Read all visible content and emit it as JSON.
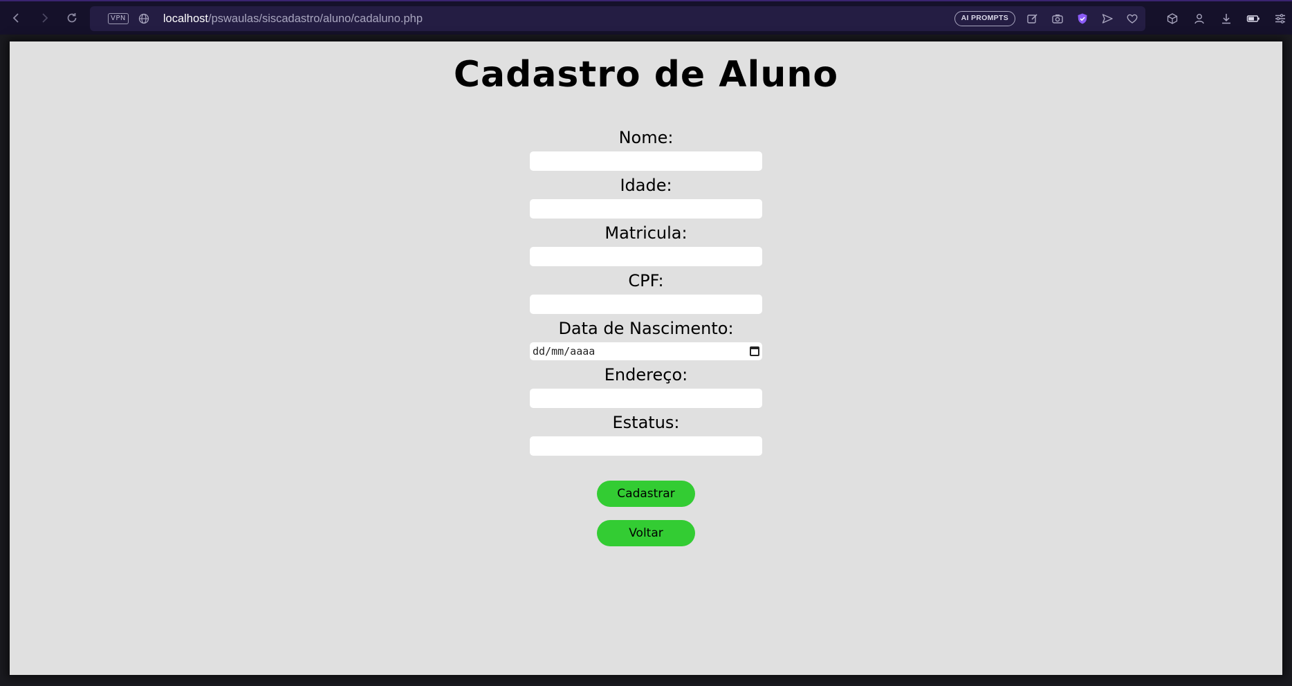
{
  "browser": {
    "vpn_label": "VPN",
    "url_host": "localhost",
    "url_path": "/pswaulas/siscadastro/aluno/cadaluno.php",
    "ai_prompts_label": "AI PROMPTS",
    "accent_color": "#8b5cf6"
  },
  "page": {
    "title": "Cadastro de Aluno",
    "background": "#e0e0e0"
  },
  "form": {
    "fields": [
      {
        "label": "Nome:",
        "value": ""
      },
      {
        "label": "Idade:",
        "value": ""
      },
      {
        "label": "Matricula:",
        "value": ""
      },
      {
        "label": "CPF:",
        "value": ""
      },
      {
        "label": "Data de Nascimento:",
        "placeholder": "dd/mm/aaaa"
      },
      {
        "label": "Endereço:",
        "value": ""
      },
      {
        "label": "Estatus:",
        "value": ""
      }
    ],
    "submit_label": "Cadastrar",
    "back_label": "Voltar",
    "button_color": "#33cc33"
  }
}
